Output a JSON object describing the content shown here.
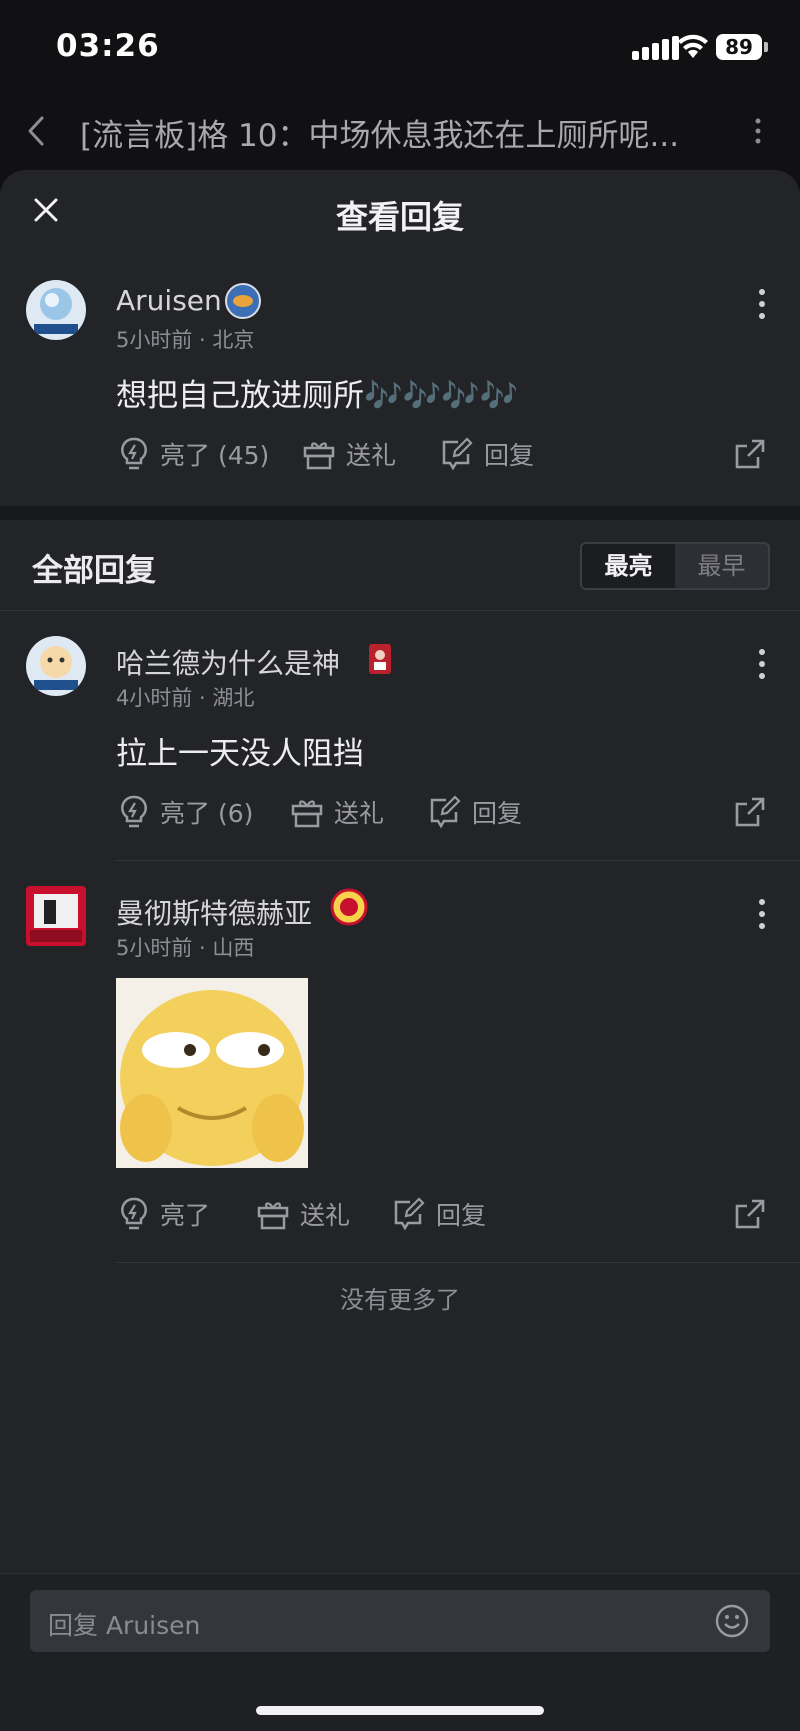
{
  "status_bar": {
    "time": "03:26",
    "battery": "89"
  },
  "background_header": {
    "title": "[流言板]格 10：中场休息我还在上厕所呢..."
  },
  "sheet": {
    "title": "查看回复"
  },
  "main_comment": {
    "author": "Aruisen",
    "time_location": "5小时前 · 北京",
    "content": "想把自己放进厕所🎶🎶🎶🎶",
    "like_label": "亮了 (45)",
    "gift_label": "送礼",
    "reply_label": "回复"
  },
  "replies_section": {
    "title": "全部回复",
    "sort_options": [
      "最亮",
      "最早"
    ],
    "active_sort": "最亮"
  },
  "replies": [
    {
      "author": "哈兰德为什么是神",
      "time_location": "4小时前 · 湖北",
      "content": "拉上一天没人阻挡",
      "like_label": "亮了 (6)",
      "gift_label": "送礼",
      "reply_label": "回复"
    },
    {
      "author": "曼彻斯特德赫亚",
      "time_location": "5小时前 · 山西",
      "content": "",
      "like_label": "亮了",
      "gift_label": "送礼",
      "reply_label": "回复",
      "has_sticker": true
    }
  ],
  "footer": {
    "no_more": "没有更多了"
  },
  "input": {
    "placeholder": "回复 Aruisen"
  },
  "colors": {
    "background": "#111113",
    "sheet": "#232428",
    "muted": "#8d8e94",
    "accent_red": "#c8102e"
  },
  "icons": [
    "back-icon",
    "more-vertical-icon",
    "close-icon",
    "lightbulb-icon",
    "gift-icon",
    "edit-reply-icon",
    "share-icon",
    "emoji-icon"
  ]
}
